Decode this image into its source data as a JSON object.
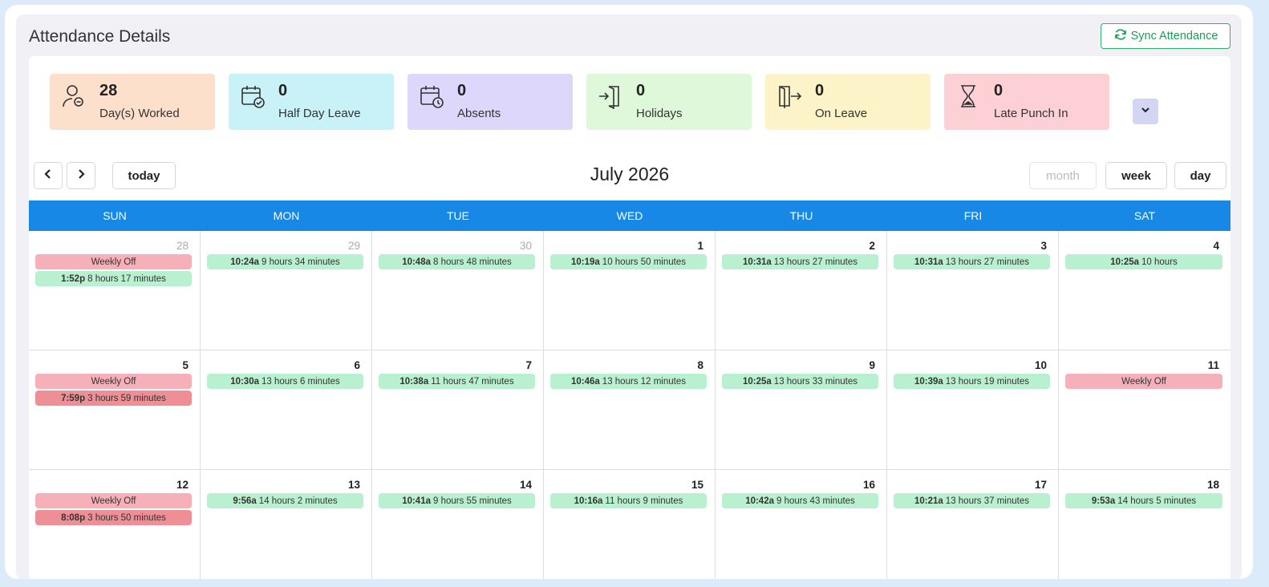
{
  "header": {
    "title": "Attendance Details",
    "sync_label": "Sync Attendance"
  },
  "stats": [
    {
      "value": "28",
      "label": "Day(s) Worked",
      "icon": "user-minus-icon",
      "color": "#fde0cc"
    },
    {
      "value": "0",
      "label": "Half Day Leave",
      "icon": "calendar-check-icon",
      "color": "#c8f2f8"
    },
    {
      "value": "0",
      "label": "Absents",
      "icon": "calendar-clock-icon",
      "color": "#dcd7fb"
    },
    {
      "value": "0",
      "label": "Holidays",
      "icon": "door-enter-icon",
      "color": "#dff8da"
    },
    {
      "value": "0",
      "label": "On Leave",
      "icon": "door-exit-icon",
      "color": "#fdf3c8"
    },
    {
      "value": "0",
      "label": "Late Punch In",
      "icon": "hourglass-icon",
      "color": "#fdd0d6"
    }
  ],
  "toolbar": {
    "today": "today",
    "month": "month",
    "week": "week",
    "day": "day"
  },
  "calendar": {
    "title": "July 2026",
    "weekdays": [
      "SUN",
      "MON",
      "TUE",
      "WED",
      "THU",
      "FRI",
      "SAT"
    ],
    "days": [
      {
        "num": "28",
        "other": true,
        "events": [
          {
            "t": "",
            "d": "Weekly Off",
            "c": "pink"
          },
          {
            "t": "1:52p",
            "d": "8 hours 17 minutes",
            "c": "green"
          }
        ]
      },
      {
        "num": "29",
        "other": true,
        "events": [
          {
            "t": "10:24a",
            "d": "9 hours 34 minutes",
            "c": "green"
          }
        ]
      },
      {
        "num": "30",
        "other": true,
        "events": [
          {
            "t": "10:48a",
            "d": "8 hours 48 minutes",
            "c": "green"
          }
        ]
      },
      {
        "num": "1",
        "events": [
          {
            "t": "10:19a",
            "d": "10 hours 50 minutes",
            "c": "green"
          }
        ]
      },
      {
        "num": "2",
        "events": [
          {
            "t": "10:31a",
            "d": "13 hours 27 minutes",
            "c": "green"
          }
        ]
      },
      {
        "num": "3",
        "events": [
          {
            "t": "10:31a",
            "d": "13 hours 27 minutes",
            "c": "green"
          }
        ]
      },
      {
        "num": "4",
        "events": [
          {
            "t": "10:25a",
            "d": "10 hours",
            "c": "green"
          }
        ]
      },
      {
        "num": "5",
        "events": [
          {
            "t": "",
            "d": "Weekly Off",
            "c": "pink"
          },
          {
            "t": "7:59p",
            "d": "3 hours 59 minutes",
            "c": "red"
          }
        ]
      },
      {
        "num": "6",
        "events": [
          {
            "t": "10:30a",
            "d": "13 hours 6 minutes",
            "c": "green"
          }
        ]
      },
      {
        "num": "7",
        "events": [
          {
            "t": "10:38a",
            "d": "11 hours 47 minutes",
            "c": "green"
          }
        ]
      },
      {
        "num": "8",
        "events": [
          {
            "t": "10:46a",
            "d": "13 hours 12 minutes",
            "c": "green"
          }
        ]
      },
      {
        "num": "9",
        "events": [
          {
            "t": "10:25a",
            "d": "13 hours 33 minutes",
            "c": "green"
          }
        ]
      },
      {
        "num": "10",
        "events": [
          {
            "t": "10:39a",
            "d": "13 hours 19 minutes",
            "c": "green"
          }
        ]
      },
      {
        "num": "11",
        "events": [
          {
            "t": "",
            "d": "Weekly Off",
            "c": "pink"
          }
        ]
      },
      {
        "num": "12",
        "events": [
          {
            "t": "",
            "d": "Weekly Off",
            "c": "pink"
          },
          {
            "t": "8:08p",
            "d": "3 hours 50 minutes",
            "c": "red"
          }
        ]
      },
      {
        "num": "13",
        "events": [
          {
            "t": "9:56a",
            "d": "14 hours 2 minutes",
            "c": "green"
          }
        ]
      },
      {
        "num": "14",
        "events": [
          {
            "t": "10:41a",
            "d": "9 hours 55 minutes",
            "c": "green"
          }
        ]
      },
      {
        "num": "15",
        "events": [
          {
            "t": "10:16a",
            "d": "11 hours 9 minutes",
            "c": "green"
          }
        ]
      },
      {
        "num": "16",
        "events": [
          {
            "t": "10:42a",
            "d": "9 hours 43 minutes",
            "c": "green"
          }
        ]
      },
      {
        "num": "17",
        "events": [
          {
            "t": "10:21a",
            "d": "13 hours 37 minutes",
            "c": "green"
          }
        ]
      },
      {
        "num": "18",
        "events": [
          {
            "t": "9:53a",
            "d": "14 hours 5 minutes",
            "c": "green"
          }
        ]
      }
    ]
  }
}
